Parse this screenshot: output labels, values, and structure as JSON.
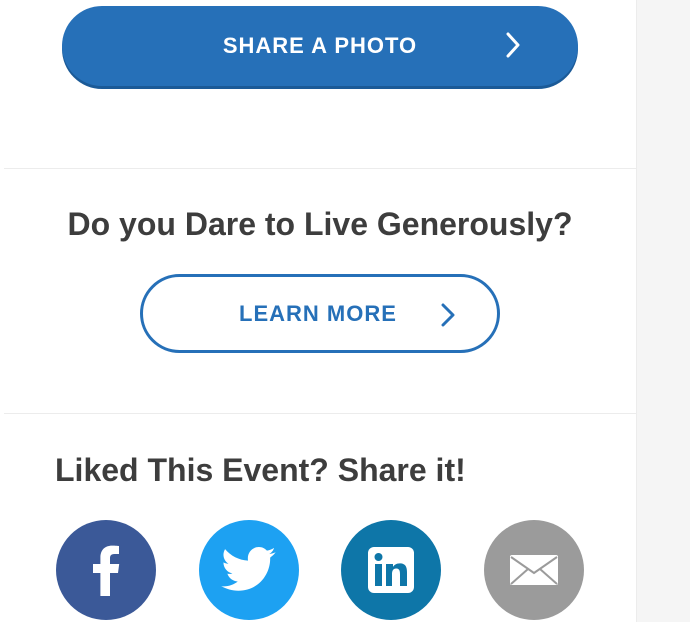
{
  "share_photo": {
    "label": "SHARE A PHOTO",
    "icon": "chevron-right-icon"
  },
  "dare": {
    "title": "Do you Dare to Live Generously?",
    "button_label": "LEARN MORE",
    "button_icon": "chevron-right-icon"
  },
  "share_event": {
    "title": "Liked This Event? Share it!",
    "buttons": [
      {
        "network": "facebook",
        "icon": "facebook-icon",
        "color": "#3b5998"
      },
      {
        "network": "twitter",
        "icon": "twitter-icon",
        "color": "#1da1f2"
      },
      {
        "network": "linkedin",
        "icon": "linkedin-icon",
        "color": "#0e76a8"
      },
      {
        "network": "email",
        "icon": "email-icon",
        "color": "#9b9b9b"
      }
    ]
  },
  "colors": {
    "primary": "#2670b8",
    "text": "#3d3d3d",
    "background": "#f5f5f5"
  }
}
